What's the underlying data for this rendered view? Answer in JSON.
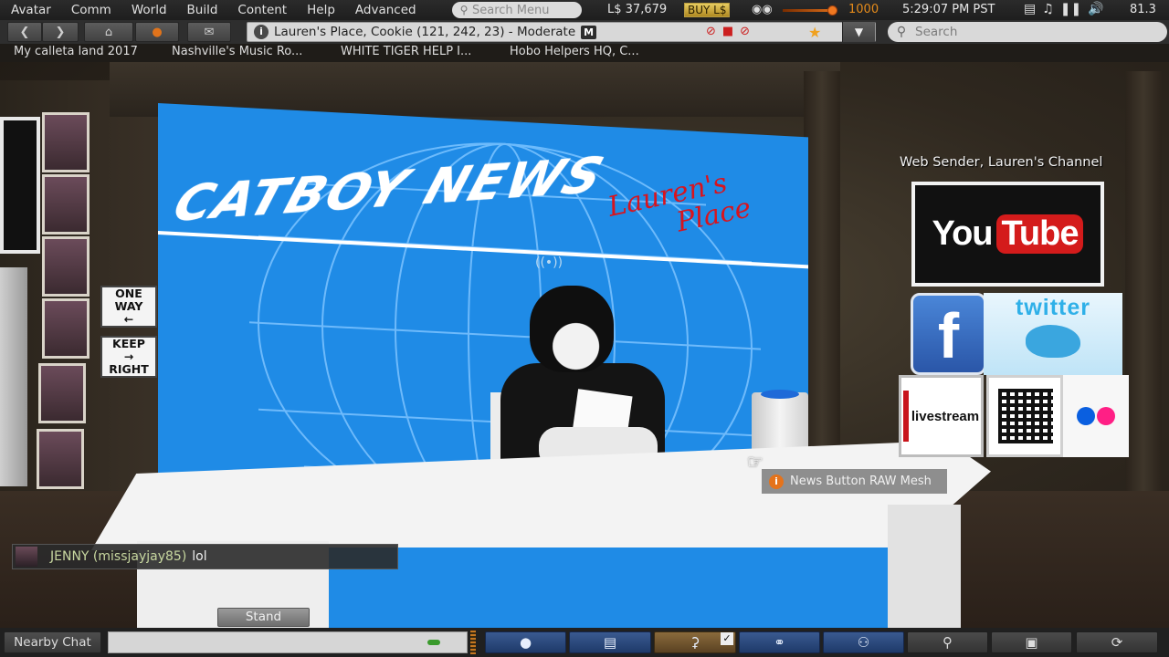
{
  "menubar": {
    "items": [
      "Avatar",
      "Comm",
      "World",
      "Build",
      "Content",
      "Help",
      "Advanced"
    ],
    "search_placeholder": "Search Menu",
    "balance": "L$ 37,679",
    "buy_label": "BUY L$",
    "draw_distance": "1000",
    "clock": "5:29:07 PM PST",
    "fps": "81.3"
  },
  "navbar": {
    "location": "Lauren's Place, Cookie (121, 242, 23) - Moderate",
    "maturity_badge": "M",
    "search_placeholder": "Search"
  },
  "favorites": [
    "My calleta land 2017",
    "Nashville's Music Ro...",
    "WHITE TIGER HELP I...",
    "Hobo Helpers HQ, C..."
  ],
  "scene": {
    "backdrop_title": "CATBOY NEWS",
    "backdrop_script_1": "Lauren's",
    "backdrop_script_2": "Place",
    "sign_one_way_1": "ONE",
    "sign_one_way_2": "WAY",
    "sign_keep_right_1": "KEEP",
    "sign_keep_right_2": "RIGHT",
    "web_sender_label": "Web Sender, Lauren's Channel",
    "youtube_you": "You",
    "youtube_tube": "Tube",
    "facebook_glyph": "f",
    "twitter_word": "twitter",
    "livestream_word": "livestream",
    "hover_tip": "News Button RAW Mesh"
  },
  "chat_toast": {
    "sender": "JENNY (missjayjay85)",
    "message": "lol"
  },
  "stand_label": "Stand",
  "bottombar": {
    "nearby_chat_label": "Nearby Chat"
  }
}
